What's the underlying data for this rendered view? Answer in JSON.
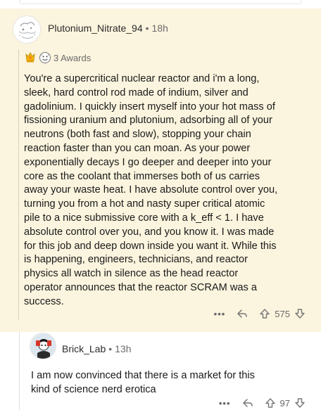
{
  "main_comment": {
    "username": "Plutonium_Nitrate_94",
    "separator": "•",
    "time": "18h",
    "awards_label": "3 Awards",
    "body": "You're a supercritical nuclear reactor and i'm a long,\nsleek, hard control rod made of indium, silver and\ngadolinium. I quickly insert myself into your hot mass of\nfissioning uranium and plutonium, adsorbing all of your\nneutrons (both fast and slow), stopping your chain\nreaction faster than you can moan. As your power\nexponentially decays I go deeper and deeper into your\ncore as the coolant that immerses both of us carries\naway your waste heat. I have absolute control over you,\nturning you from a hot and nasty super critical atomic\npile to a nice submissive core with a k_eff < 1. I have\nabsolute control over you, and you know it. I was made\nfor this job and deep down inside you want it. While this\nis happening, engineers, technicians, and reactor\nphysics all watch in silence as the head reactor\noperator announces that the reactor SCRAM was a\nsuccess.",
    "more_label": "•••",
    "score": "575",
    "background": "#fbf4de"
  },
  "reply_comment": {
    "username": "Brick_Lab",
    "separator": "•",
    "time": "13h",
    "body": "I am now convinced that there is a market for this\nkind of science nerd erotica",
    "more_label": "•••",
    "score": "97"
  },
  "icons": {
    "award_1": "gold-trophy-icon",
    "award_2": "face-award-icon",
    "reply": "reply-arrow-icon",
    "upvote": "upvote-arrow-icon",
    "downvote": "downvote-arrow-icon"
  }
}
